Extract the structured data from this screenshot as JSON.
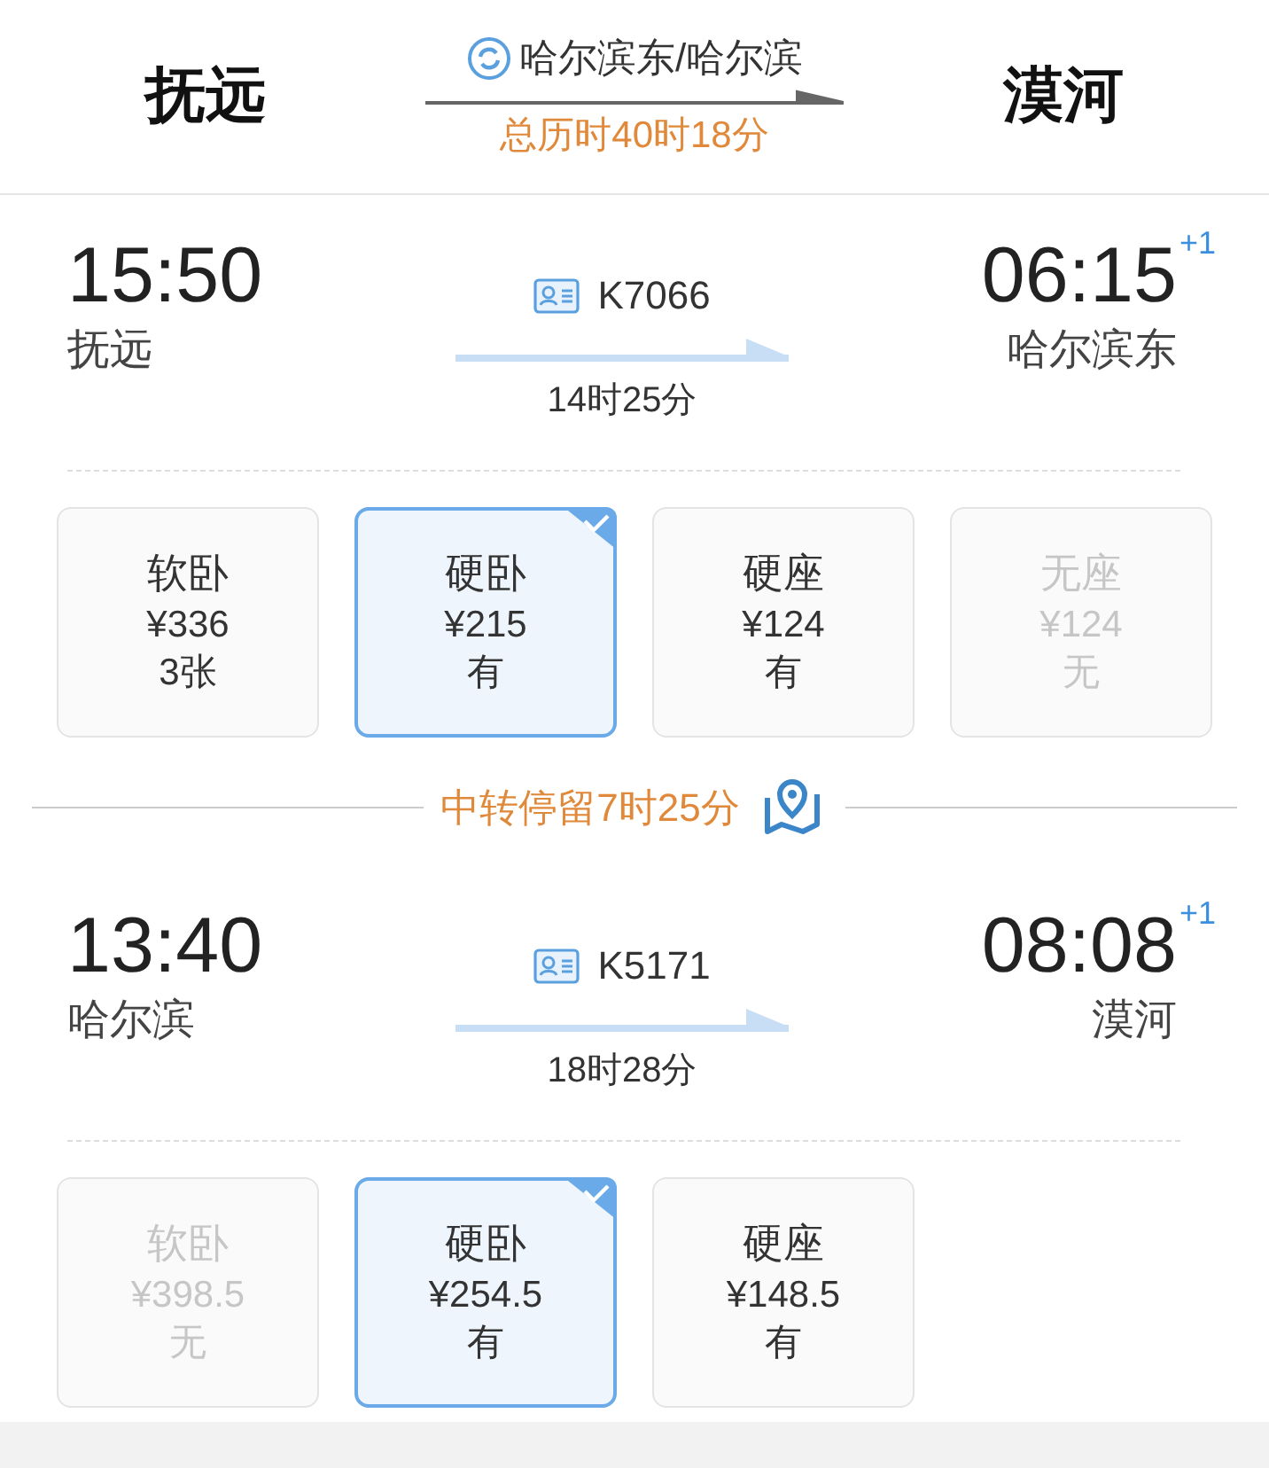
{
  "header": {
    "from": "抚远",
    "to": "漠河",
    "via": "哈尔滨东/哈尔滨",
    "total_time": "总历时40时18分"
  },
  "legs": [
    {
      "depart_time": "15:50",
      "depart_station": "抚远",
      "train": "K7066",
      "duration": "14时25分",
      "arrive_time": "06:15",
      "arrive_day": "+1",
      "arrive_station": "哈尔滨东",
      "seats": [
        {
          "name": "软卧",
          "price": "¥336",
          "stock": "3张",
          "selected": false,
          "available": true
        },
        {
          "name": "硬卧",
          "price": "¥215",
          "stock": "有",
          "selected": true,
          "available": true
        },
        {
          "name": "硬座",
          "price": "¥124",
          "stock": "有",
          "selected": false,
          "available": true
        },
        {
          "name": "无座",
          "price": "¥124",
          "stock": "无",
          "selected": false,
          "available": false
        }
      ]
    },
    {
      "depart_time": "13:40",
      "depart_station": "哈尔滨",
      "train": "K5171",
      "duration": "18时28分",
      "arrive_time": "08:08",
      "arrive_day": "+1",
      "arrive_station": "漠河",
      "seats": [
        {
          "name": "软卧",
          "price": "¥398.5",
          "stock": "无",
          "selected": false,
          "available": false
        },
        {
          "name": "硬卧",
          "price": "¥254.5",
          "stock": "有",
          "selected": true,
          "available": true
        },
        {
          "name": "硬座",
          "price": "¥148.5",
          "stock": "有",
          "selected": false,
          "available": true
        }
      ]
    }
  ],
  "transfer": {
    "text": "中转停留7时25分"
  }
}
